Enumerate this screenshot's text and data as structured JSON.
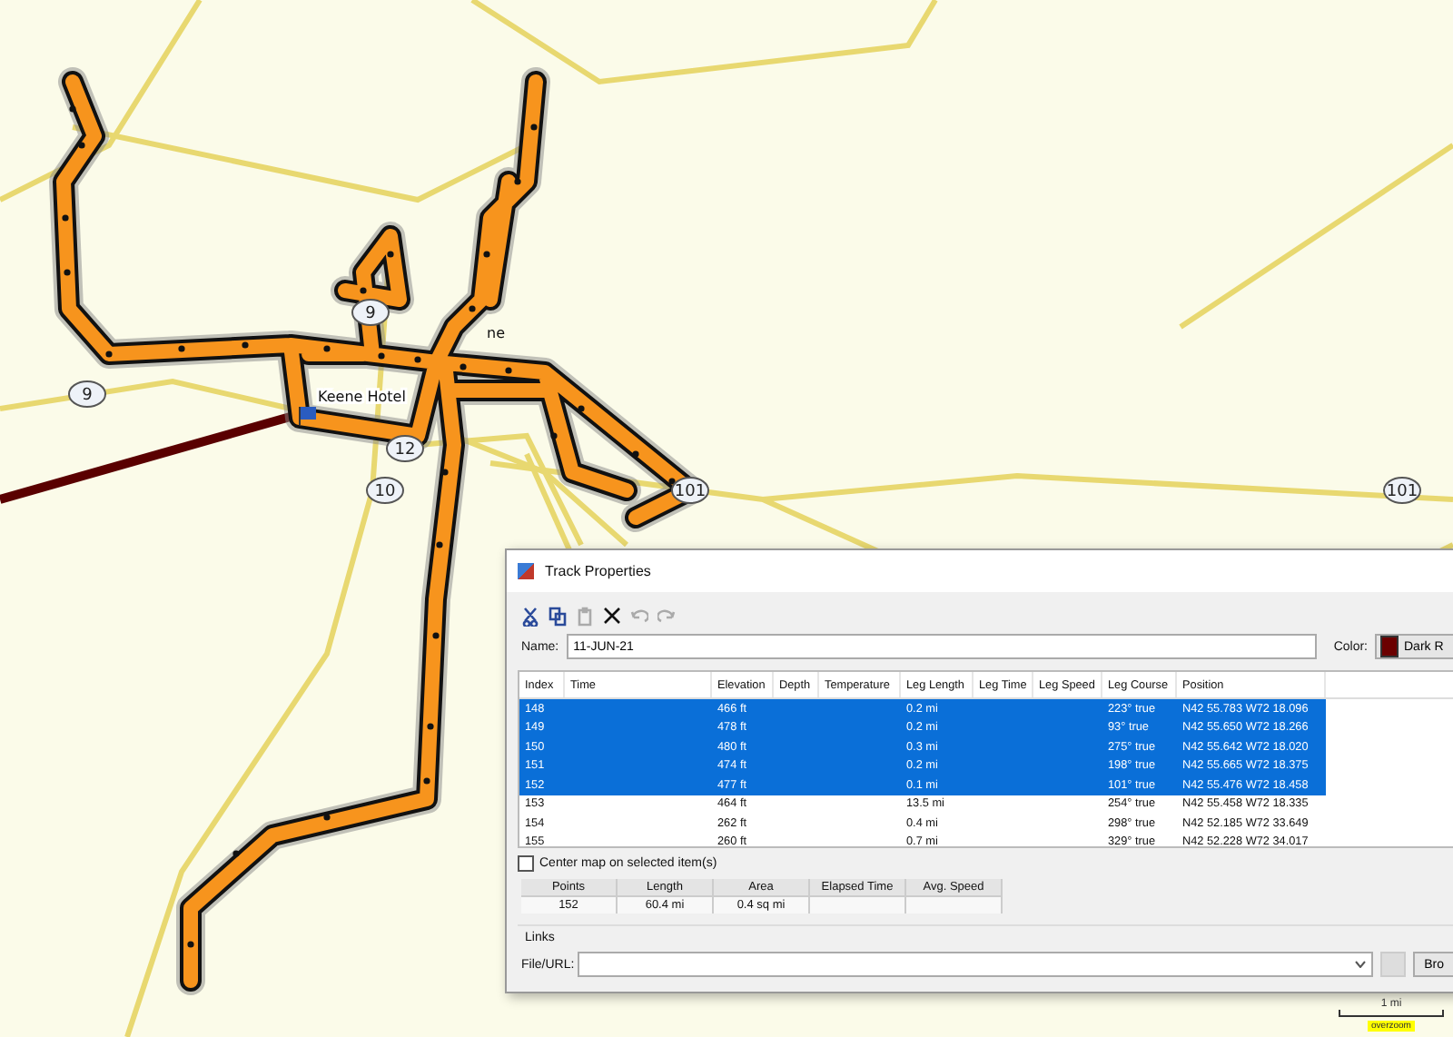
{
  "map": {
    "road_shields": [
      "9",
      "9",
      "12",
      "10",
      "101",
      "101"
    ],
    "places": [
      "Keene Hotel",
      "ne"
    ],
    "scale": {
      "label": "1 mi",
      "badge": "overzoom"
    }
  },
  "dialog": {
    "title": "Track Properties",
    "name_label": "Name:",
    "name_value": "11-JUN-21",
    "color_label": "Color:",
    "color_value": "Dark R",
    "color": "#6b0000",
    "table": {
      "columns": [
        "Index",
        "Time",
        "Elevation",
        "Depth",
        "Temperature",
        "Leg Length",
        "Leg Time",
        "Leg Speed",
        "Leg Course",
        "Position"
      ],
      "rows": [
        {
          "index": "148",
          "elevation": "466 ft",
          "leg_length": "0.2 mi",
          "leg_course": "223° true",
          "position": "N42 55.783 W72 18.096",
          "selected": true
        },
        {
          "index": "149",
          "elevation": "478 ft",
          "leg_length": "0.2 mi",
          "leg_course": "93° true",
          "position": "N42 55.650 W72 18.266",
          "selected": true
        },
        {
          "index": "150",
          "elevation": "480 ft",
          "leg_length": "0.3 mi",
          "leg_course": "275° true",
          "position": "N42 55.642 W72 18.020",
          "selected": true
        },
        {
          "index": "151",
          "elevation": "474 ft",
          "leg_length": "0.2 mi",
          "leg_course": "198° true",
          "position": "N42 55.665 W72 18.375",
          "selected": true
        },
        {
          "index": "152",
          "elevation": "477 ft",
          "leg_length": "0.1 mi",
          "leg_course": "101° true",
          "position": "N42 55.476 W72 18.458",
          "selected": true
        },
        {
          "index": "153",
          "elevation": "464 ft",
          "leg_length": "13.5 mi",
          "leg_course": "254° true",
          "position": "N42 55.458 W72 18.335",
          "selected": false
        },
        {
          "index": "154",
          "elevation": "262 ft",
          "leg_length": "0.4 mi",
          "leg_course": "298° true",
          "position": "N42 52.185 W72 33.649",
          "selected": false
        },
        {
          "index": "155",
          "elevation": "260 ft",
          "leg_length": "0.7 mi",
          "leg_course": "329° true",
          "position": "N42 52.228 W72 34.017",
          "selected": false
        }
      ]
    },
    "center_map": {
      "label": "Center map on selected item(s)",
      "checked": false
    },
    "stats": {
      "columns": [
        "Points",
        "Length",
        "Area",
        "Elapsed Time",
        "Avg. Speed"
      ],
      "values": [
        "152",
        "60.4 mi",
        "0.4 sq mi"
      ]
    },
    "links": {
      "title": "Links",
      "field_label": "File/URL:",
      "browse_label": "Bro"
    }
  }
}
